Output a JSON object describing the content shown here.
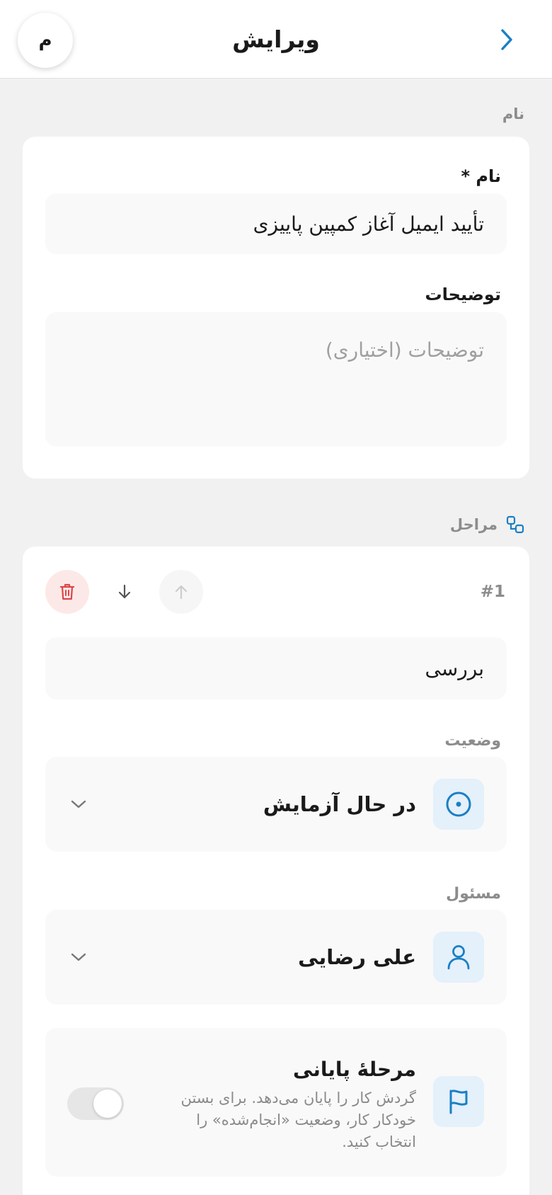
{
  "header": {
    "title": "ویرایش",
    "avatar_initial": "م"
  },
  "name_section": {
    "label": "نام",
    "name_label": "نام *",
    "name_value": "تأیید ایمیل آغاز کمپین پاییزی",
    "description_label": "توضیحات",
    "description_placeholder": "توضیحات (اختیاری)"
  },
  "steps_section": {
    "label": "مراحل",
    "steps": [
      {
        "number": "#1",
        "title": "بررسی",
        "status_label": "وضعیت",
        "status_value": "در حال آزمایش",
        "assignee_label": "مسئول",
        "assignee_value": "علی رضایی",
        "final_stage_title": "مرحلهٔ پایانی",
        "final_stage_desc_lines": [
          "گردش کار را پایان می‌دهد. برای بستن",
          "خودکار کار، وضعیت «انجام‌شده» را",
          "انتخاب کنید."
        ],
        "final_stage_enabled": false
      }
    ]
  },
  "colors": {
    "accent": "#1a7fc4",
    "danger": "#d94848",
    "danger_bg": "#fde8e8",
    "icon_tile_bg": "#e4f0fa"
  },
  "icons": {
    "back": "chevron-right-icon",
    "steps": "nodes-icon",
    "delete": "trash-icon",
    "move_down": "arrow-down-icon",
    "move_up": "arrow-up-icon",
    "status": "target-circle-icon",
    "assignee": "user-icon",
    "final": "flag-icon",
    "dropdown": "chevron-down-icon"
  }
}
